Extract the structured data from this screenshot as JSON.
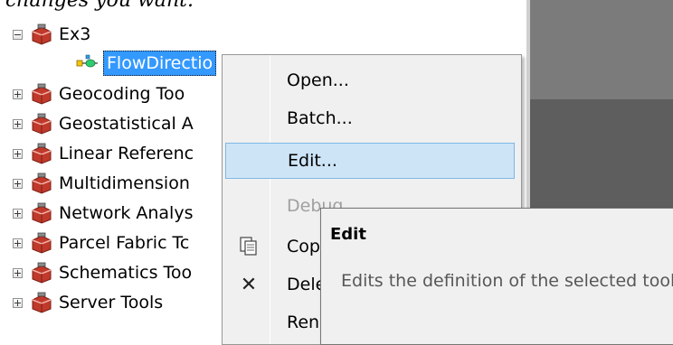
{
  "header_text": "changes you want.",
  "tree": {
    "root": {
      "label": "Ex3",
      "expanded": true
    },
    "selected_tool": {
      "label": "FlowDirectio"
    },
    "items": [
      {
        "label": "Geocoding Too"
      },
      {
        "label": "Geostatistical A"
      },
      {
        "label": "Linear Referenc"
      },
      {
        "label": "Multidimension"
      },
      {
        "label": "Network Analys"
      },
      {
        "label": "Parcel Fabric Tc"
      },
      {
        "label": "Schematics Too"
      },
      {
        "label": "Server Tools"
      }
    ]
  },
  "context_menu": {
    "items": [
      {
        "label": "Open...",
        "state": "normal"
      },
      {
        "label": "Batch...",
        "state": "normal"
      },
      {
        "label": "Edit...",
        "state": "highlighted"
      },
      {
        "label": "Debug...",
        "state": "disabled"
      },
      {
        "label": "Cop",
        "state": "normal",
        "icon": "copy-icon"
      },
      {
        "label": "Dele",
        "state": "normal",
        "icon": "delete-icon"
      },
      {
        "label": "Ren",
        "state": "normal"
      }
    ]
  },
  "tooltip": {
    "title": "Edit",
    "description": "Edits the definition of the selected tool"
  },
  "colors": {
    "selection_blue": "#3399ff",
    "menu_highlight": "#cde4f7",
    "menu_highlight_border": "#7fb7e6",
    "toolbox_red": "#c0392b"
  }
}
